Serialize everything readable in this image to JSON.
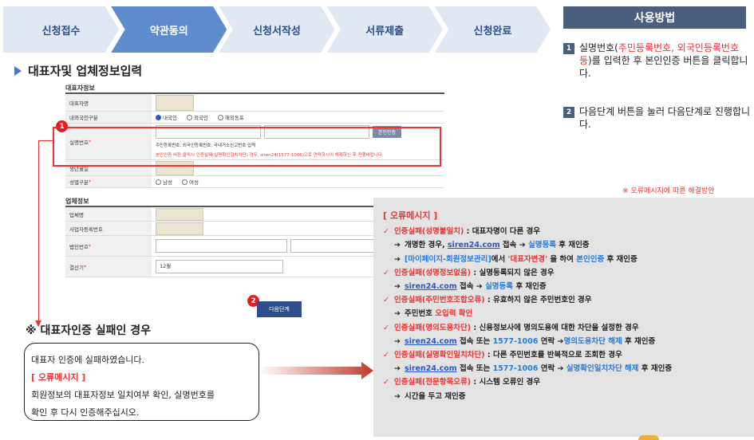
{
  "steps": [
    "신청접수",
    "약관동의",
    "신청서작성",
    "서류제출",
    "신청완료"
  ],
  "form_title": "대표자및 업체정보입력",
  "rep": {
    "section": "대표자정보",
    "name_label": "대표자명",
    "nationality_label": "내외국인구분",
    "nat_options": [
      "내국인",
      "외국인",
      "해외동포"
    ],
    "idno_label": "실명번호",
    "auth_button": "본인인증",
    "hint": "주민등록번호, 외국인등록번호, 국내거소신고번호 입력",
    "hint_red": "본인인증 버튼 클릭시 인증실패(실명확인일치차단) 경우, siren24(1577-1006)으로 연락하시어 해제하신 후 진행바랍니다.",
    "birth_label": "생년월일",
    "gender_label": "성별구분",
    "gender_options": [
      "남성",
      "여성"
    ]
  },
  "biz": {
    "section": "업체정보",
    "name_label": "업체명",
    "regno_label": "사업자등록번호",
    "corpno_label": "법인번호",
    "settle_label": "결산기",
    "settle_value": "12월"
  },
  "next_button": "다음단계",
  "badge1": "1",
  "badge2": "2",
  "fail": {
    "title": "※ 대표자인증 실패인 경우",
    "line1": "대표자 인증에 실패하였습니다.",
    "err_label": "[ 오류메시지 ]",
    "line2": "회원정보의 대표자정보 일치여부 확인, 실명번호를",
    "line3": "확인 후 다시 인증해주십시오."
  },
  "how": {
    "title": "사용방법",
    "item1_num": "1",
    "item1_a": "실명번호(",
    "item1_red": "주민등록번호, 외국인등록번호 등",
    "item1_b": ")를 입력한 후 본인인증 버튼을 클릭합니다.",
    "item2_num": "2",
    "item2": "다음단계 버튼을 눌러 다음단계로 진행합니다."
  },
  "solution": "※ 오류메시지에 따른 해결방안",
  "errors": {
    "head": "[ 오류메시지 ]",
    "e1_title": "인증실패(성명불일치)",
    "e1_desc": " : 대표자명이 다른 경우",
    "e1_s1_a": "개명한 경우, ",
    "e1_s1_link": "siren24.com",
    "e1_s1_b": " 접속 ",
    "e1_s1_c": "실명등록",
    "e1_s1_d": " 후 재인증",
    "e1_s2_a": "[마이페이지-회원정보관리]",
    "e1_s2_b": "에서 ",
    "e1_s2_c": "'대표자변경'",
    "e1_s2_d": " 을 하여 ",
    "e1_s2_e": "본인인증",
    "e1_s2_f": " 후 재인증",
    "e2_title": "인증실패(성명정보없음)",
    "e2_desc": " : 실명등록되지 않은 경우",
    "e2_s1_link": "siren24.com",
    "e2_s1_a": " 접속 ",
    "e2_s1_b": "실명등록",
    "e2_s1_c": " 후 재인증",
    "e3_title": "인증실패(주민번호조합오류)",
    "e3_desc": " : 유효하지 않은 주민번호인 경우",
    "e3_s1_a": "주민번호 ",
    "e3_s1_b": "오입력 확인",
    "e4_title": "인증실패(명의도용차단)",
    "e4_desc": " : 신용정보사에 명의도용에 대한 차단을 설정한 경우",
    "e4_s1_link": "siren24.com",
    "e4_s1_a": " 접속 또는 ",
    "e4_s1_b": "1577-1006",
    "e4_s1_c": " 연락 ",
    "e4_s1_d": "명의도용차단 해제",
    "e4_s1_e": " 후 재인증",
    "e5_title": "인증실패(실명확인일치차단)",
    "e5_desc": " : 다른 주민번호를 반복적으로 조회한 경우",
    "e5_s1_link": "siren24.com",
    "e5_s1_a": " 접속 또는 ",
    "e5_s1_b": "1577-1006",
    "e5_s1_c": " 연락 ",
    "e5_s1_d": "실명확인일치차단 해제",
    "e5_s1_e": " 후 재인증",
    "e6_title": "인증실패(전문항목오류)",
    "e6_desc": " : 시스템 오류인 경우",
    "e6_s1": "시간을 두고 재인증",
    "check": "✓",
    "arrow": "➔"
  },
  "colors": {
    "accent": "#5e8ccc",
    "error": "#e33333",
    "panel": "#e3e3e3",
    "header": "#4a5f7d"
  }
}
